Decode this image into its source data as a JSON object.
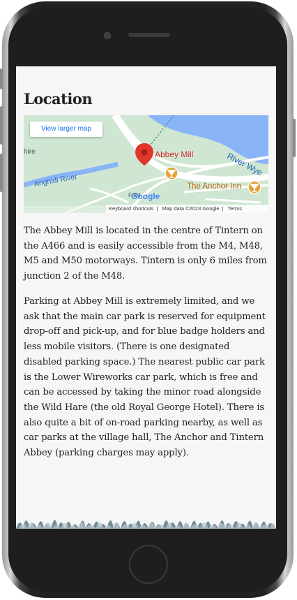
{
  "page": {
    "title": "Location",
    "paragraphs": [
      "The Abbey Mill is located in the centre of Tintern on the A466 and is easily accessible from the M4, M48, M5 and M50 motorways. Tintern is only 6 miles from junction 2 of the M48.",
      "Parking at Abbey Mill is extremely limited, and we ask that the main car park is reserved for equipment drop-off and pick-up, and for blue badge holders and less mobile visitors. (There is one designated disabled parking space.) The nearest public car park is the Lower Wireworks car park, which is free and can be accessed by taking the minor road alongside the Wild Hare (the old Royal George Hotel). There is also quite a bit of on-road parking nearby, as well as car parks at the village hall, The Anchor and Tintern Abbey (parking charges may apply)."
    ]
  },
  "map": {
    "view_larger_label": "View larger map",
    "labels": {
      "abbey_mill": "Abbey Mill",
      "river_wye": "River Wye",
      "anghidi_river": "Anghidi River",
      "anchor_inn": "The Anchor Inn",
      "shire": "hire",
      "road": "F Rd"
    },
    "google_logo": "Google",
    "attribution": {
      "shortcuts": "Keyboard shortcuts",
      "map_data": "Map data ©2023 Google",
      "terms": "Terms"
    },
    "colors": {
      "land": "#cfe7d2",
      "water": "#8ab4f8",
      "road": "#ffffff",
      "pin": "#e0362b",
      "poi": "#e8a23b",
      "link": "#1a73e8"
    }
  },
  "icons": [
    "map-pin-icon",
    "bar-icon",
    "cocktail-icon"
  ]
}
